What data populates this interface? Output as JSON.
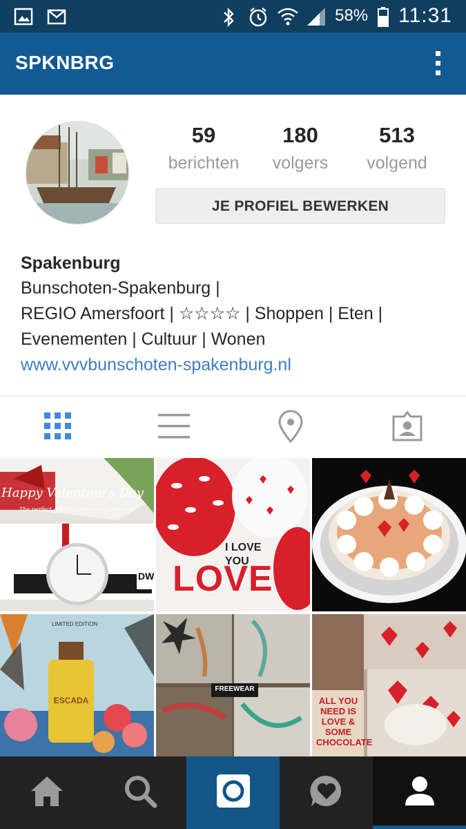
{
  "status_bar": {
    "battery": "58%",
    "time": "11:31",
    "icons": [
      "gallery-icon",
      "gmail-icon",
      "bluetooth-icon",
      "alarm-icon",
      "wifi-icon",
      "signal-icon",
      "battery-icon"
    ]
  },
  "app_bar": {
    "title": "SPKNBRG",
    "menu_icon": "more-vert-icon"
  },
  "profile": {
    "stats": [
      {
        "value": "59",
        "label": "berichten"
      },
      {
        "value": "180",
        "label": "volgers"
      },
      {
        "value": "513",
        "label": "volgend"
      }
    ],
    "edit_button": "JE PROFIEL BEWERKEN",
    "name": "Spakenburg",
    "bio_lines": [
      "Bunschoten-Spakenburg |",
      "REGIO Amersfoort | ☆☆☆☆ | Shoppen | Eten |",
      "Evenementen | Cultuur | Wonen"
    ],
    "website": "www.vvvbunschoten-spakenburg.nl"
  },
  "view_tabs": [
    {
      "icon": "grid-icon",
      "active": true
    },
    {
      "icon": "list-icon",
      "active": false
    },
    {
      "icon": "location-pin-icon",
      "active": false
    },
    {
      "icon": "tagged-photos-icon",
      "active": false
    }
  ],
  "posts": [
    {
      "caption_text": "Happy Valentine's Day",
      "sub_text": "The perfect gift for your special someone",
      "brand": "DW"
    },
    {
      "caption_text": "I LOVE YOU",
      "big_text": "LOVE"
    },
    {
      "caption_text": "cake"
    },
    {
      "caption_text": "LIMITED EDITION",
      "brand": "ESCADA"
    },
    {
      "caption_text": "FREEWEAR"
    },
    {
      "caption_text": "ALL YOU NEED IS LOVE & SOME CHOCOLATE"
    }
  ],
  "bottom_nav": [
    {
      "icon": "home-icon",
      "active": false
    },
    {
      "icon": "search-icon",
      "active": false
    },
    {
      "icon": "camera-icon",
      "active": false
    },
    {
      "icon": "activity-heart-icon",
      "active": false
    },
    {
      "icon": "profile-icon",
      "active": true
    }
  ],
  "colors": {
    "status_bar": "#0f3e5e",
    "app_bar": "#135a92",
    "accent_blue": "#3f8ad9",
    "link": "#3f7ec0",
    "bottom_nav": "#222222",
    "bottom_nav_active": "#111111",
    "camera_tab": "#125688"
  }
}
